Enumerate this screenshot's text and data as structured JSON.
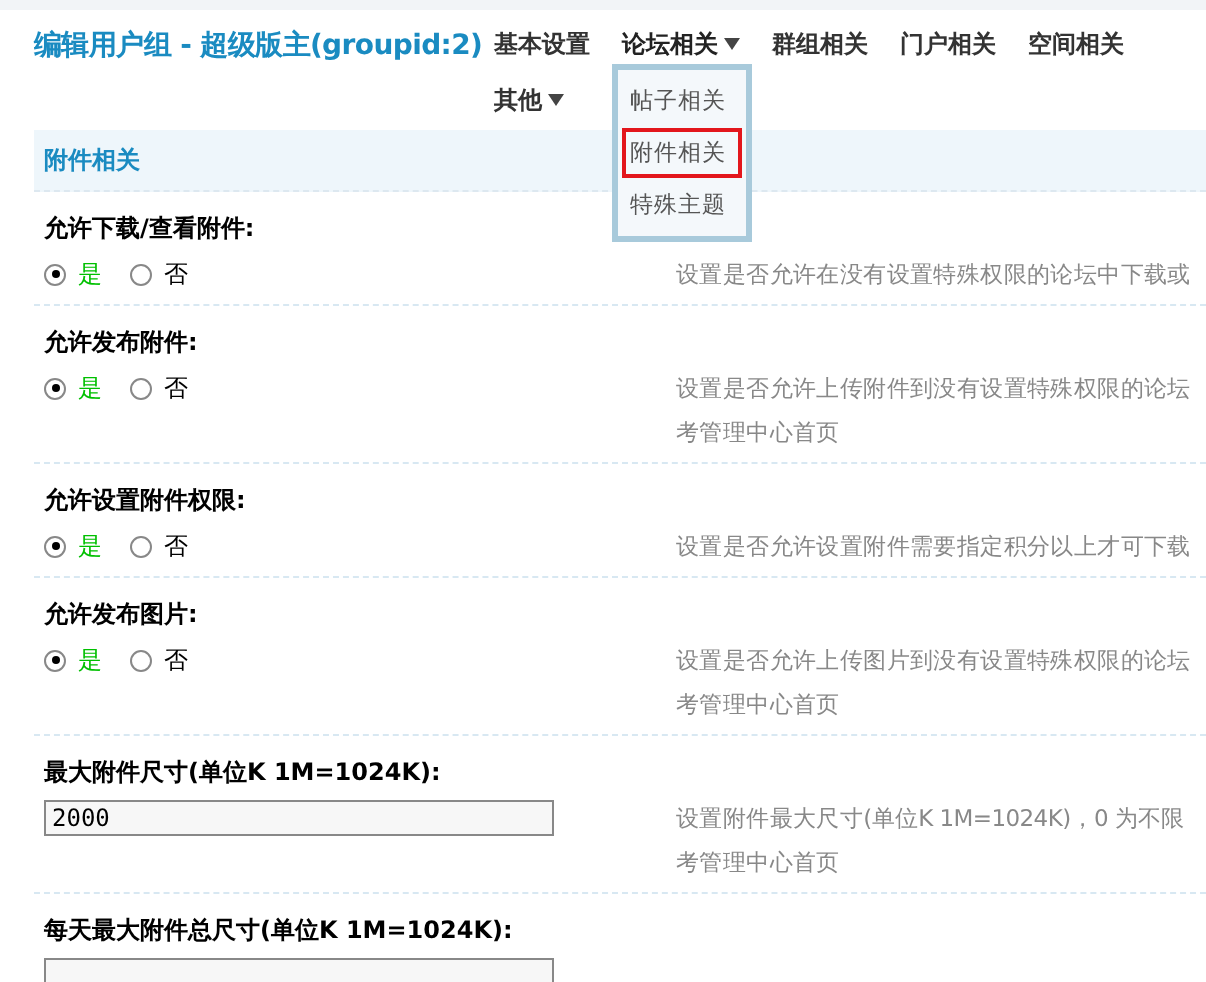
{
  "title": "编辑用户组 - 超级版主(groupid:2)",
  "nav": [
    {
      "label": "基本设置",
      "has_menu": false,
      "selected": false
    },
    {
      "label": "论坛相关",
      "has_menu": true,
      "selected": true,
      "menu": [
        {
          "label": "帖子相关",
          "selected": false
        },
        {
          "label": "附件相关",
          "selected": true
        },
        {
          "label": "特殊主题",
          "selected": false
        }
      ]
    },
    {
      "label": "群组相关",
      "has_menu": false,
      "selected": false
    },
    {
      "label": "门户相关",
      "has_menu": false,
      "selected": false
    },
    {
      "label": "空间相关",
      "has_menu": false,
      "selected": false
    },
    {
      "label": "其他",
      "has_menu": true,
      "selected": false
    }
  ],
  "section": "附件相关",
  "settings": [
    {
      "kind": "radio",
      "label": "允许下载/查看附件:",
      "options": [
        {
          "label": "是",
          "selected": true
        },
        {
          "label": "否",
          "selected": false
        }
      ],
      "hint": [
        "设置是否允许在没有设置特殊权限的论坛中下载或"
      ]
    },
    {
      "kind": "radio",
      "label": "允许发布附件:",
      "options": [
        {
          "label": "是",
          "selected": true
        },
        {
          "label": "否",
          "selected": false
        }
      ],
      "hint": [
        "设置是否允许上传附件到没有设置特殊权限的论坛",
        "考管理中心首页"
      ]
    },
    {
      "kind": "radio",
      "label": "允许设置附件权限:",
      "options": [
        {
          "label": "是",
          "selected": true
        },
        {
          "label": "否",
          "selected": false
        }
      ],
      "hint": [
        "设置是否允许设置附件需要指定积分以上才可下载"
      ]
    },
    {
      "kind": "radio",
      "label": "允许发布图片:",
      "options": [
        {
          "label": "是",
          "selected": true
        },
        {
          "label": "否",
          "selected": false
        }
      ],
      "hint": [
        "设置是否允许上传图片到没有设置特殊权限的论坛",
        "考管理中心首页"
      ]
    },
    {
      "kind": "text",
      "label": "最大附件尺寸(单位K 1M=1024K):",
      "value": "2000",
      "hint": [
        "设置附件最大尺寸(单位K 1M=1024K)，0 为不限",
        "考管理中心首页"
      ]
    },
    {
      "kind": "text",
      "label": "每天最大附件总尺寸(单位K 1M=1024K):"
    }
  ]
}
